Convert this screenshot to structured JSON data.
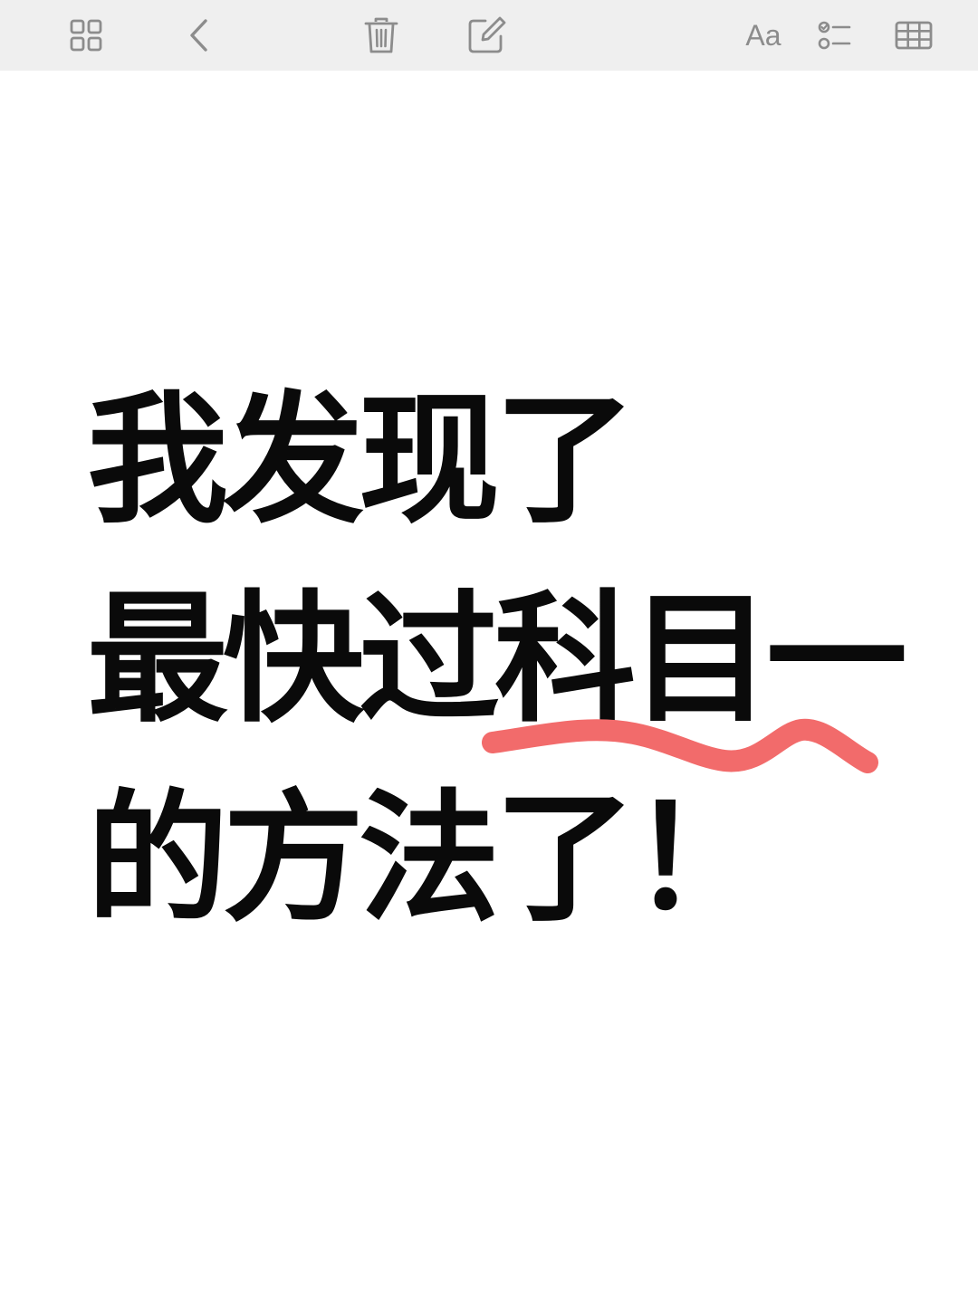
{
  "toolbar": {
    "font_label": "Aa",
    "icons": [
      "gallery-icon",
      "back-icon",
      "trash-icon",
      "compose-icon",
      "font-icon",
      "checklist-icon",
      "table-icon"
    ],
    "icon_color": "#8c8c8c"
  },
  "note": {
    "lines": [
      "我发现了",
      "最快过科目一",
      "的方法了！"
    ],
    "text_color": "#0a0a0a",
    "underline_color": "#f26b6b"
  }
}
